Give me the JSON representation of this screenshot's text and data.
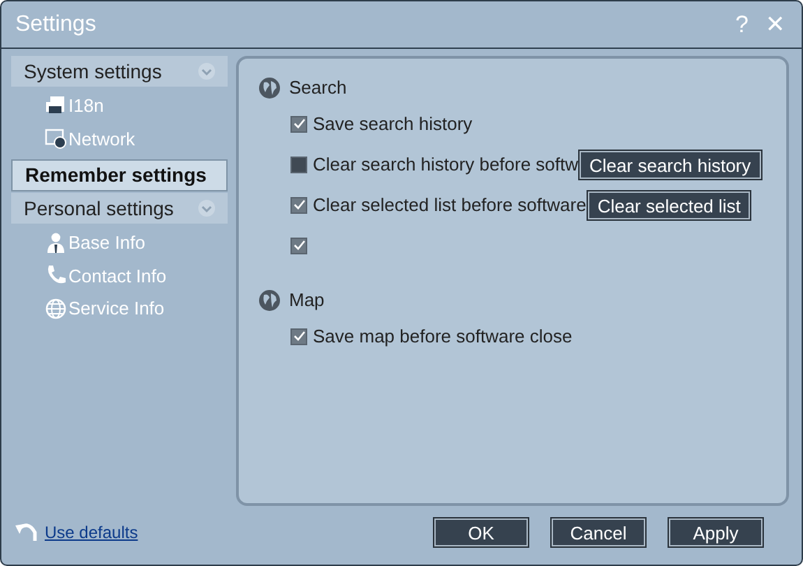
{
  "window": {
    "title": "Settings",
    "controls": [
      "?",
      "✕"
    ]
  },
  "sidebar": {
    "items": [
      {
        "label": "System settings",
        "selected": false,
        "expanded": true,
        "children": [
          {
            "label": "I18n"
          },
          {
            "label": "Network"
          }
        ]
      },
      {
        "label": "Remember settings",
        "selected": true
      },
      {
        "label": "Personal settings",
        "selected": false,
        "expanded": true,
        "children": [
          {
            "label": "Base Info"
          },
          {
            "label": "Contact Info"
          },
          {
            "label": "Service Info"
          }
        ]
      }
    ]
  },
  "sections": [
    {
      "title": "Search",
      "options": [
        {
          "label": "Save search history",
          "checked": true
        },
        {
          "label": "Clear search history before softw",
          "checked": false,
          "button": "Clear search history"
        },
        {
          "label": "Clear selected list before software",
          "checked": true,
          "button": "Clear selected list"
        },
        {
          "checked": true
        }
      ]
    },
    {
      "title": "Map",
      "options": [
        {
          "label": "Save map before software close",
          "checked": true
        }
      ]
    }
  ],
  "footer": {
    "link": "Use defaults",
    "buttons": [
      "OK",
      "Cancel",
      "Apply"
    ]
  }
}
